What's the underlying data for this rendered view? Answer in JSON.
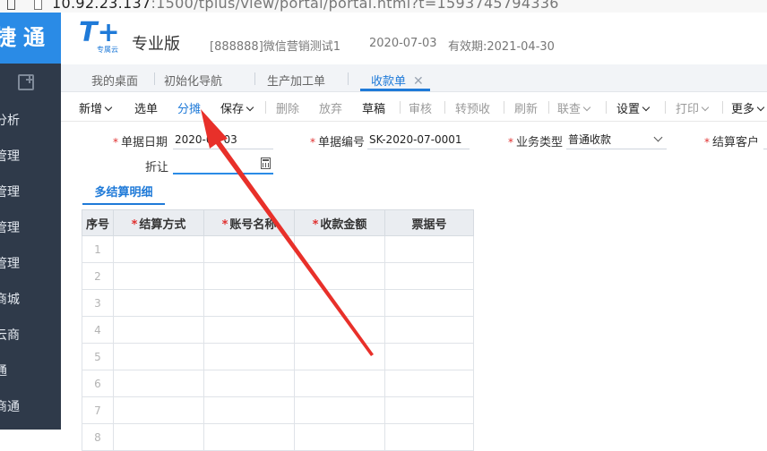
{
  "browser": {
    "url_host": "10.92.23.137",
    "url_rest": ":1500/tplus/view/portal/portal.html?t=1593745794336"
  },
  "sidebar": {
    "brand": "捷通",
    "items": [
      {
        "label": "分析"
      },
      {
        "label": "管理"
      },
      {
        "label": "管理"
      },
      {
        "label": "管理"
      },
      {
        "label": "管理"
      },
      {
        "label": "商城"
      },
      {
        "label": "云商"
      },
      {
        "label": "通"
      },
      {
        "label": "商通"
      }
    ]
  },
  "header": {
    "logo_mark": "T+",
    "logo_sub": "专属云",
    "edition": "专业版",
    "company": "[888888]微信营销测试1",
    "date": "2020-07-03",
    "validity": "有效期:2021-04-30"
  },
  "tabs": [
    {
      "label": "我的桌面"
    },
    {
      "label": "初始化导航"
    },
    {
      "label": "生产加工单"
    },
    {
      "label": "收款单",
      "close": "✕"
    }
  ],
  "toolbar": {
    "new": "新增",
    "select": "选单",
    "split": "分摊",
    "save": "保存",
    "delete": "删除",
    "discard": "放弃",
    "draft": "草稿",
    "audit": "审核",
    "prepay": "转预收",
    "refresh": "刷新",
    "linked_query": "联查",
    "settings": "设置",
    "print": "打印",
    "more": "更多"
  },
  "form": {
    "doc_date_label": "单据日期",
    "doc_date": "2020-07-03",
    "doc_no_label": "单据编号",
    "doc_no": "SK-2020-07-0001",
    "biz_type_label": "业务类型",
    "biz_type": "普通收款",
    "customer_label": "结算客户",
    "customer": "",
    "discount_label": "折让",
    "discount": ""
  },
  "detail": {
    "tab": "多结算明细",
    "columns": [
      "序号",
      "结算方式",
      "账号名称",
      "收款金额",
      "票据号"
    ],
    "required": [
      false,
      true,
      true,
      true,
      false
    ],
    "rows": [
      "1",
      "2",
      "3",
      "4",
      "5",
      "6",
      "7",
      "8"
    ]
  },
  "annotation": {
    "arrow_color": "#e8302a"
  }
}
